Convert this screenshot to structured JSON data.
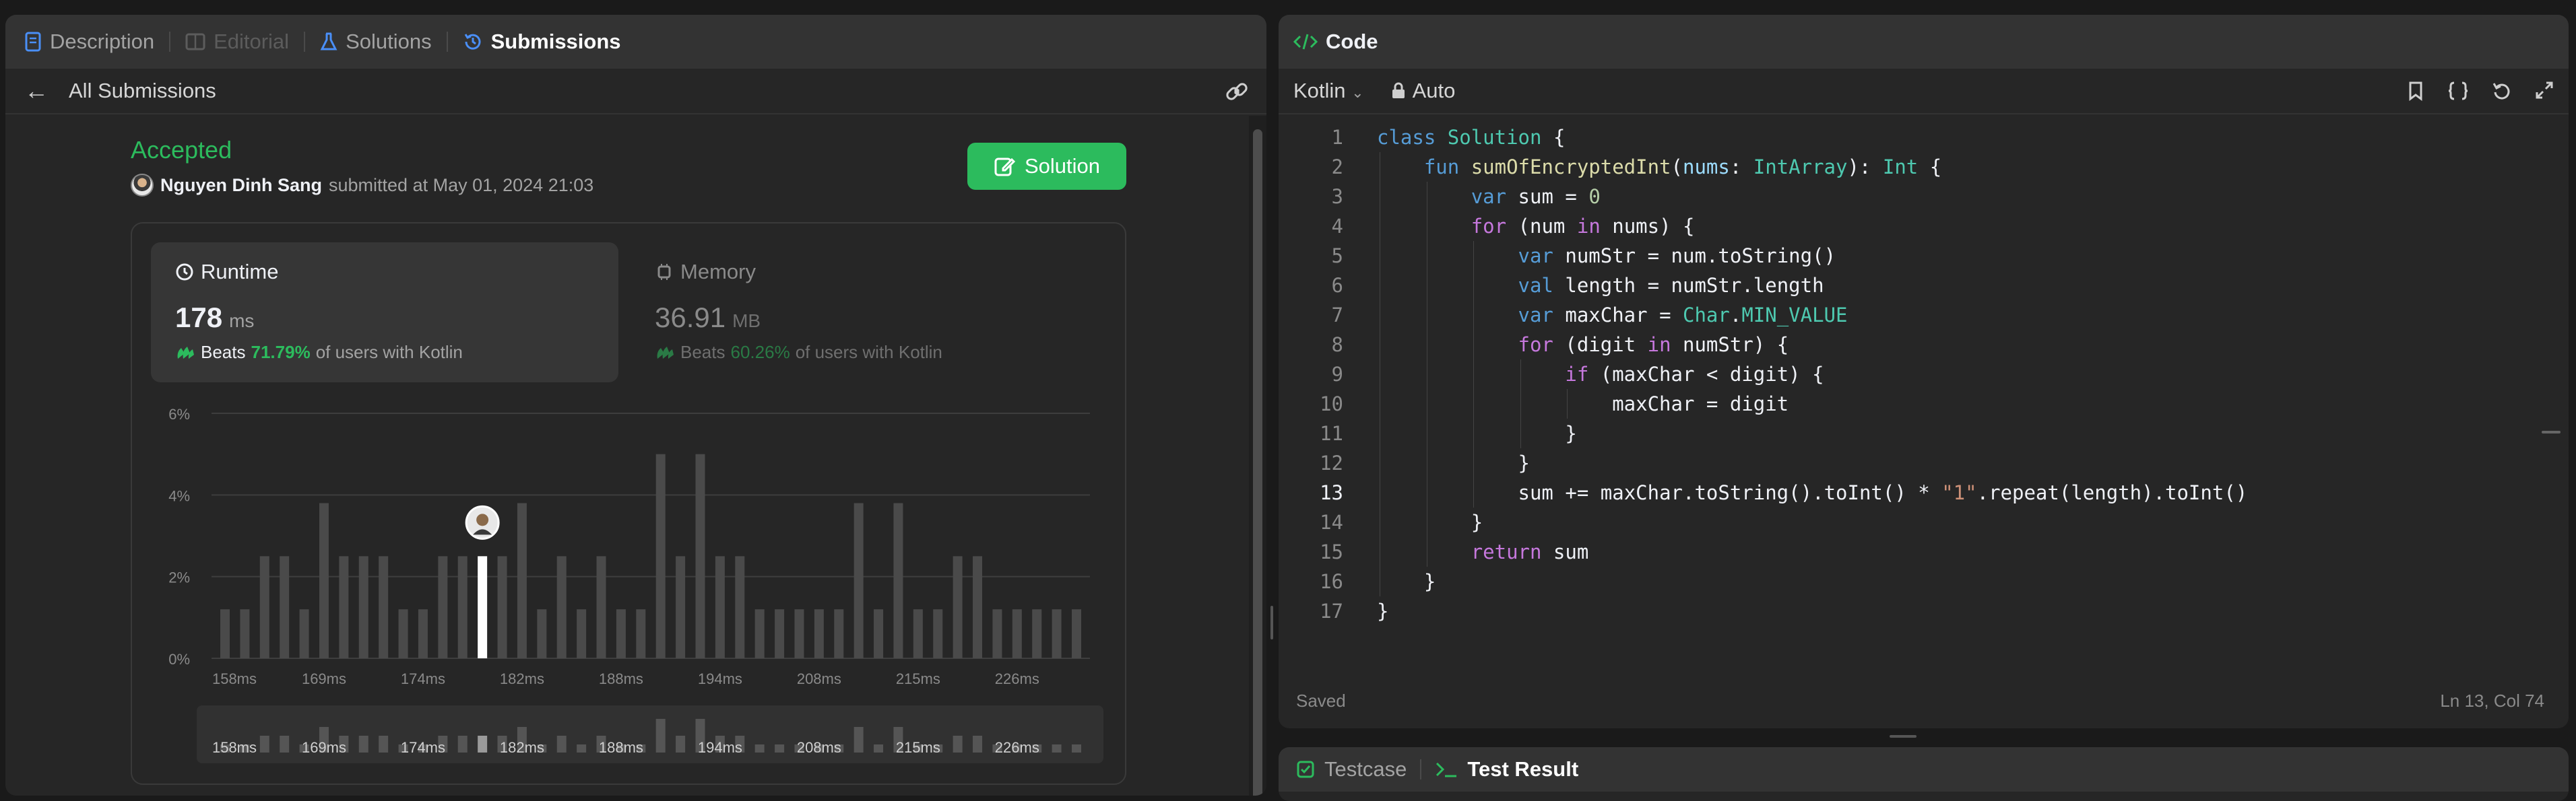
{
  "tabs": [
    {
      "label": "Description"
    },
    {
      "label": "Editorial"
    },
    {
      "label": "Solutions"
    },
    {
      "label": "Submissions"
    }
  ],
  "subbar": {
    "back_label": "All Submissions"
  },
  "submission": {
    "status": "Accepted",
    "author": "Nguyen Dinh Sang",
    "submitted_text": "submitted at May 01, 2024 21:03",
    "solution_button": "Solution"
  },
  "runtime": {
    "title": "Runtime",
    "value": "178",
    "unit": "ms",
    "beats_label": "Beats",
    "beats_pct": "71.79%",
    "beats_suffix": "of users with Kotlin"
  },
  "memory": {
    "title": "Memory",
    "value": "36.91",
    "unit": "MB",
    "beats_label": "Beats",
    "beats_pct": "60.26%",
    "beats_suffix": "of users with Kotlin"
  },
  "chart_data": {
    "type": "bar",
    "ylabel": "",
    "xlabel": "",
    "y_ticks": [
      "6%",
      "4%",
      "2%",
      "0%"
    ],
    "ylim": [
      0,
      6
    ],
    "x_tick_labels": [
      "158ms",
      "169ms",
      "174ms",
      "182ms",
      "188ms",
      "194ms",
      "208ms",
      "215ms",
      "226ms"
    ],
    "values": [
      1.2,
      1.2,
      2.5,
      2.5,
      1.2,
      3.8,
      2.5,
      2.5,
      2.5,
      1.2,
      1.2,
      2.5,
      2.5,
      2.5,
      2.5,
      3.8,
      1.2,
      2.5,
      1.2,
      2.5,
      1.2,
      1.2,
      5.0,
      2.5,
      5.0,
      2.5,
      2.5,
      1.2,
      1.2,
      1.2,
      1.2,
      1.2,
      3.8,
      1.2,
      3.8,
      1.2,
      1.2,
      2.5,
      2.5,
      1.2,
      1.2,
      1.2,
      1.2,
      1.2
    ],
    "highlight_index": 13,
    "highlight_color": "#ffffff",
    "bar_color": "#4a4a4a",
    "grid": true
  },
  "code_panel": {
    "title": "Code",
    "language": "Kotlin",
    "mode": "Auto",
    "saved": "Saved",
    "cursor": "Ln 13, Col 74",
    "current_line": 13,
    "lines": [
      "class Solution {",
      "    fun sumOfEncryptedInt(nums: IntArray): Int {",
      "        var sum = 0",
      "        for (num in nums) {",
      "            var numStr = num.toString()",
      "            val length = numStr.length",
      "            var maxChar = Char.MIN_VALUE",
      "            for (digit in numStr) {",
      "                if (maxChar < digit) {",
      "                    maxChar = digit",
      "                }",
      "            }",
      "            sum += maxChar.toString().toInt() * \"1\".repeat(length).toInt()",
      "        }",
      "        return sum",
      "    }",
      "}"
    ]
  },
  "bottom_tabs": [
    {
      "label": "Testcase"
    },
    {
      "label": "Test Result"
    }
  ],
  "colors": {
    "accent": "#2cbb5d",
    "panel": "#262626",
    "header": "#333333"
  }
}
